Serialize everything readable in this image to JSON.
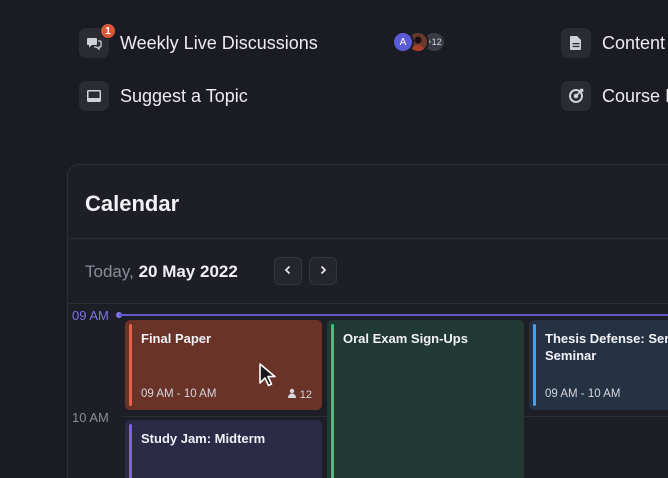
{
  "links": {
    "weekly": {
      "label": "Weekly Live Discussions",
      "badge": "1"
    },
    "suggest": {
      "label": "Suggest a Topic"
    },
    "content": {
      "label": "Content"
    },
    "course": {
      "label": "Course I"
    }
  },
  "participants": {
    "initial": "A",
    "more": "+12"
  },
  "calendar": {
    "title": "Calendar",
    "today_label": "Today,",
    "date": "20 May 2022",
    "times": [
      "09 AM",
      "10 AM"
    ],
    "events": [
      {
        "title": "Final Paper",
        "time": "09 AM - 10 AM",
        "count": "12"
      },
      {
        "title": "Oral Exam Sign-Ups"
      },
      {
        "title": "Thesis Defense: Senior Seminar",
        "time": "09 AM - 10 AM"
      },
      {
        "title": "Study Jam: Midterm"
      }
    ]
  },
  "colors": {
    "background": "#1b1c23",
    "accent": "#7b74e8",
    "final_paper": "#6a3328",
    "oral_exam": "#213a33",
    "thesis": "#253244",
    "study_jam": "#2b2a47"
  }
}
